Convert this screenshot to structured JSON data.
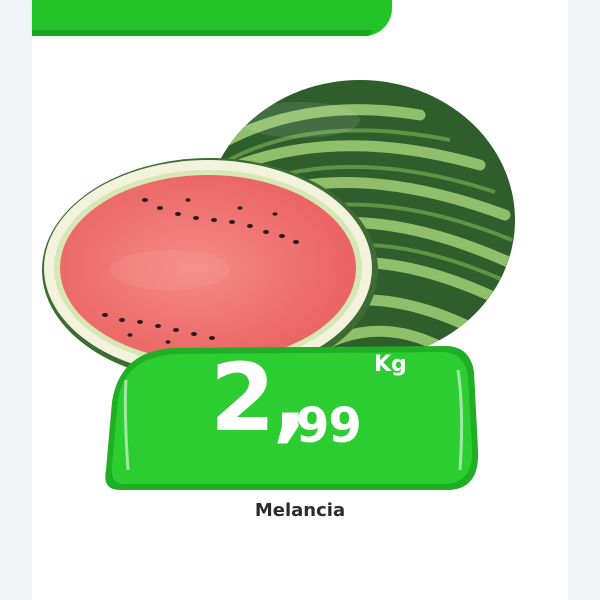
{
  "colors": {
    "tag_green": "#22c229",
    "tag_green_dark": "#17a31c",
    "flesh": "#ef6f6d",
    "rind_dark": "#2f5e2c",
    "rind_light": "#8fbf6a"
  },
  "image": {
    "icon": "watermelon-icon"
  },
  "price": {
    "integer": "2,",
    "decimals": "99",
    "unit": "Kg"
  },
  "product": {
    "name": "Melancia"
  }
}
